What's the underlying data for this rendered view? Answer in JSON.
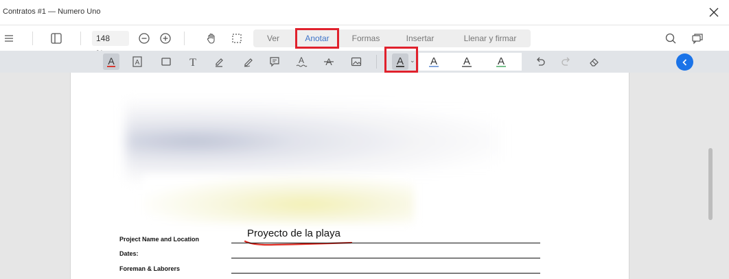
{
  "window": {
    "title": "Contratos #1 — Numero Uno"
  },
  "toolbar": {
    "zoom_level": "148 %",
    "tabs": [
      {
        "label": "Ver",
        "active": false
      },
      {
        "label": "Anotar",
        "active": true
      },
      {
        "label": "Formas",
        "active": false
      },
      {
        "label": "Insertar",
        "active": false
      },
      {
        "label": "Llenar y firmar",
        "active": false
      }
    ]
  },
  "annotation_toolbar": {
    "text_color_glyph": "A",
    "underline_colors": [
      "#3e74c9",
      "#333333",
      "#2e9e4f"
    ],
    "selected_text_color": "#333333"
  },
  "document": {
    "form_labels": {
      "project": "Project Name and Location",
      "dates": "Dates:",
      "foreman": "Foreman & Laborers"
    },
    "project_value": "Proyecto de la playa"
  },
  "colors": {
    "accent": "#1a73e8",
    "highlight_box": "#e0212c",
    "annotation_underline": "#d9271e"
  }
}
